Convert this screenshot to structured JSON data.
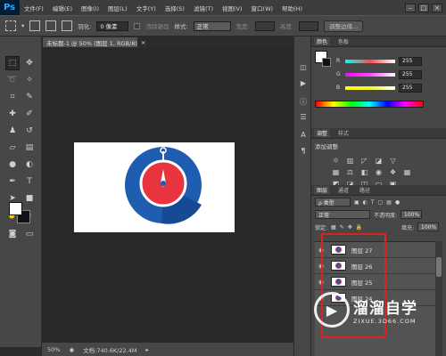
{
  "menubar": {
    "logo": "Ps",
    "items": [
      "文件(F)",
      "编辑(E)",
      "图像(I)",
      "图层(L)",
      "文字(Y)",
      "选择(S)",
      "滤镜(T)",
      "视图(V)",
      "窗口(W)",
      "帮助(H)"
    ]
  },
  "options": {
    "feather_label": "羽化:",
    "feather_value": "0 像素",
    "antialias_label": "消除锯齿",
    "style_label": "样式:",
    "style_value": "正常",
    "width_label": "宽度:",
    "height_label": "高度:",
    "refine_button": "调整边缘..."
  },
  "document": {
    "tab_title": "未标题-1 @ 50% (图层 1, RGB/8)",
    "zoom": "50%",
    "doc_info": "文档:740.6K/22.4M"
  },
  "color_panel": {
    "tabs": [
      "颜色",
      "色板"
    ],
    "channels": [
      {
        "name": "R",
        "value": "255",
        "color": "#ff4d4d"
      },
      {
        "name": "G",
        "value": "255",
        "color": "#ff4dff"
      },
      {
        "name": "B",
        "value": "255",
        "color": "#f5f52a"
      }
    ]
  },
  "adjustments_panel": {
    "tabs": [
      "调整",
      "样式"
    ],
    "title": "添加调整"
  },
  "layers_panel": {
    "tabs": [
      "图层",
      "通道",
      "路径"
    ],
    "filter_label": "ρ 类型",
    "blend_mode": "正常",
    "opacity_label": "不透明度:",
    "opacity_value": "100%",
    "fill_label": "填充:",
    "fill_value": "100%",
    "lock_label": "锁定:",
    "layers": [
      "图层 27",
      "图层 26",
      "图层 25",
      "图层 24"
    ]
  },
  "watermark": {
    "main": "溜溜自学",
    "sub": "ZIXUE.3D66.COM"
  },
  "colors": {
    "logo_blue": "#1e5db0",
    "logo_red": "#e8343e",
    "highlight": "#e02020"
  }
}
